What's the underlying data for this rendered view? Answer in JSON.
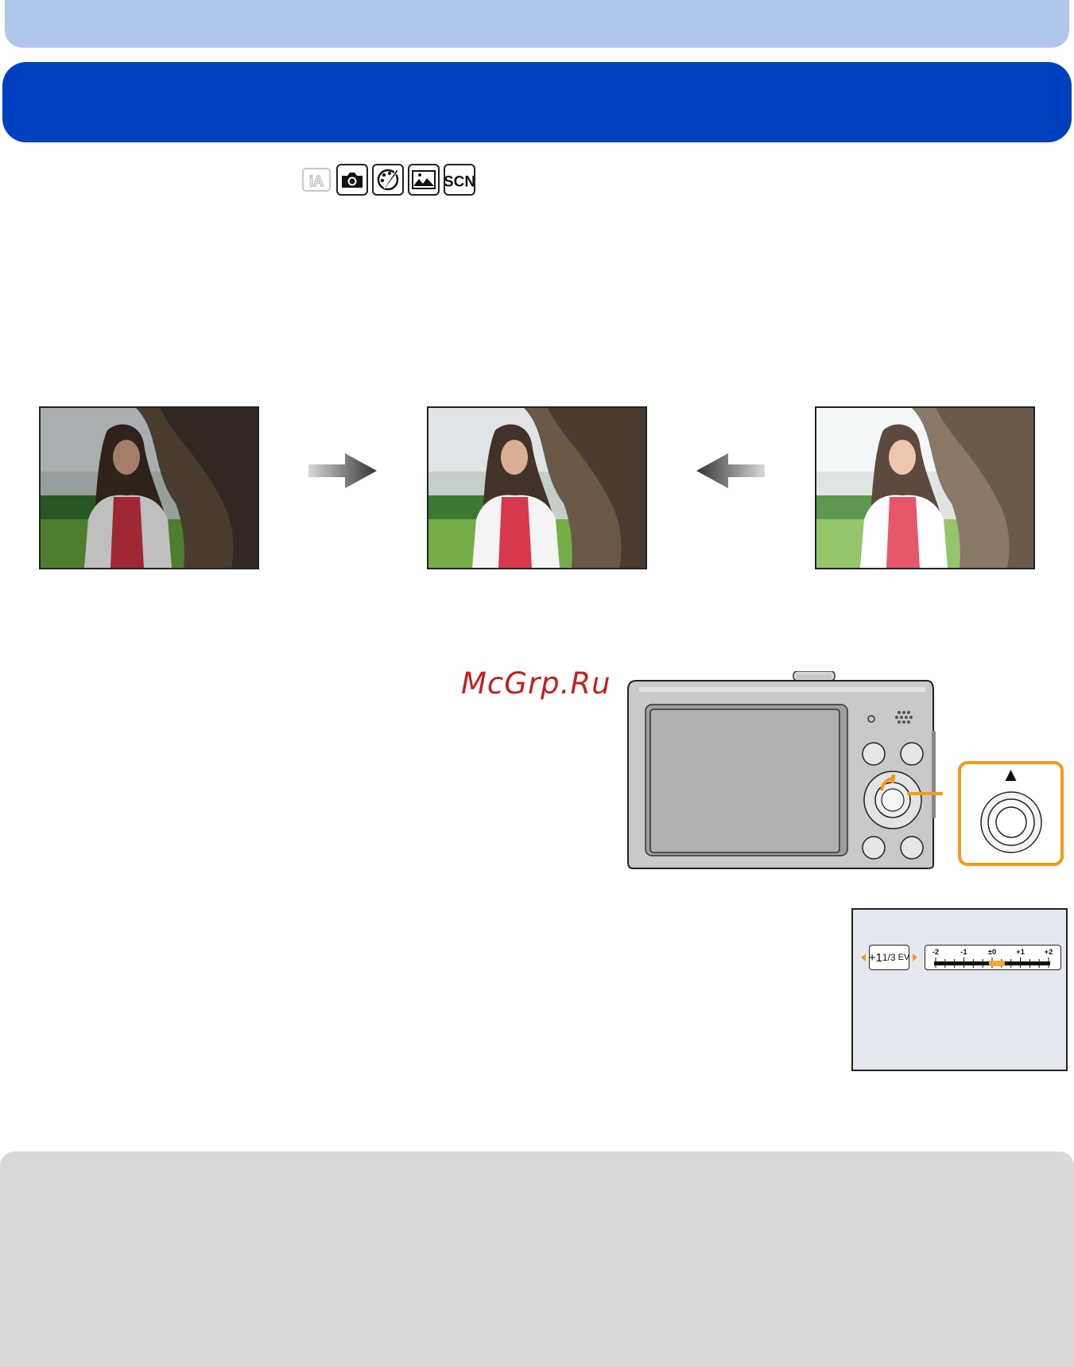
{
  "header": {
    "band": "light-blue-band",
    "title_band": "dark-blue-title-band"
  },
  "colors": {
    "light_band": "#b0c6ec",
    "title_band": "#0040c0",
    "highlight": "#f29a1c",
    "watermark": "#c62020",
    "note_band": "#d9d9d9"
  },
  "mode_icons": [
    {
      "name": "intelligent-auto-icon",
      "label": "iA",
      "enabled": false
    },
    {
      "name": "camera-icon",
      "label": "",
      "enabled": true
    },
    {
      "name": "creative-palette-icon",
      "label": "",
      "enabled": true
    },
    {
      "name": "panorama-icon",
      "label": "",
      "enabled": true
    },
    {
      "name": "scene-mode-icon",
      "label": "SCN",
      "enabled": true
    }
  ],
  "exposure_examples": [
    {
      "name": "underexposed-photo",
      "exposure": "dark"
    },
    {
      "name": "correct-exposure-photo",
      "exposure": "normal"
    },
    {
      "name": "overexposed-photo",
      "exposure": "bright"
    }
  ],
  "watermark": "McGrp.Ru",
  "camera": {
    "highlighted_button": "up-cursor-button",
    "zoom_symbol": "▲"
  },
  "ev_screen": {
    "value_main": "+1",
    "value_frac": "1/3",
    "unit": "EV",
    "scale_labels": [
      "-2",
      "-1",
      "±0",
      "+1",
      "+2"
    ],
    "scale_min": -2,
    "scale_max": 2,
    "selected_value": 0.333
  }
}
